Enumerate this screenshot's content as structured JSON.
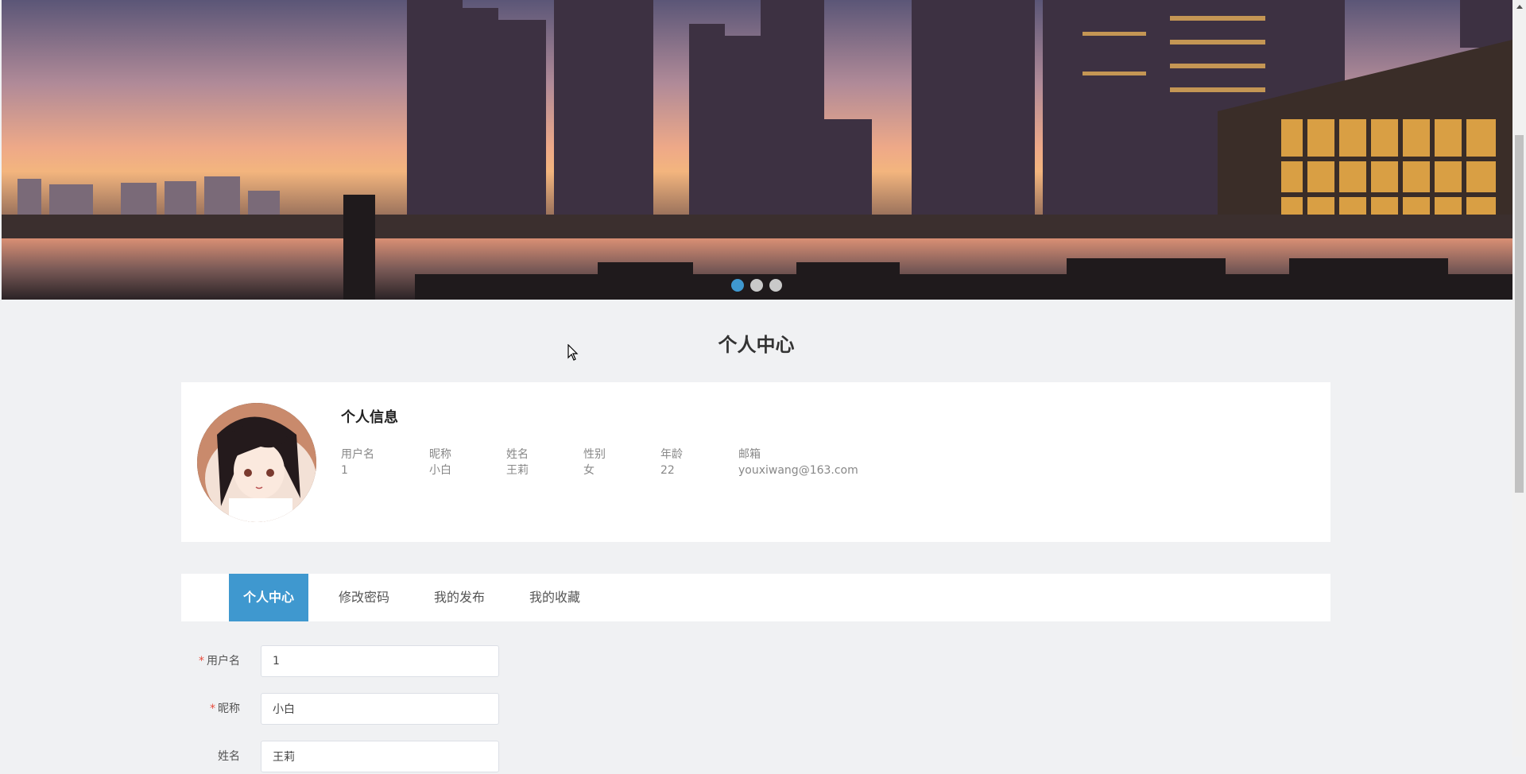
{
  "banner": {
    "dots": [
      {
        "active": true
      },
      {
        "active": false
      },
      {
        "active": false
      }
    ]
  },
  "page_title": "个人中心",
  "profile": {
    "section_title": "个人信息",
    "fields": [
      {
        "label": "用户名",
        "value": "1"
      },
      {
        "label": "昵称",
        "value": "小白"
      },
      {
        "label": "姓名",
        "value": "王莉"
      },
      {
        "label": "性别",
        "value": "女"
      },
      {
        "label": "年龄",
        "value": "22"
      },
      {
        "label": "邮箱",
        "value": "youxiwang@163.com"
      }
    ]
  },
  "tabs": [
    {
      "label": "个人中心",
      "active": true
    },
    {
      "label": "修改密码",
      "active": false
    },
    {
      "label": "我的发布",
      "active": false
    },
    {
      "label": "我的收藏",
      "active": false
    }
  ],
  "form": {
    "username": {
      "label": "用户名",
      "value": "1",
      "required": true
    },
    "nickname": {
      "label": "昵称",
      "value": "小白",
      "required": true
    },
    "name": {
      "label": "姓名",
      "value": "王莉",
      "required": false
    }
  },
  "colors": {
    "accent": "#3f98cf",
    "required": "#e74c3c",
    "page_background": "#f0f1f3"
  }
}
